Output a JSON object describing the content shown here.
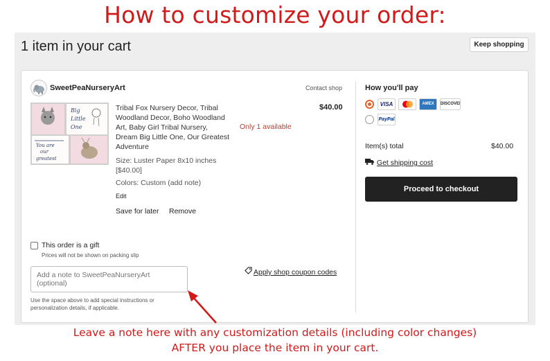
{
  "headline": "How to customize your order:",
  "cart": {
    "title": "1 item in your cart",
    "keep_shopping": "Keep shopping"
  },
  "shop": {
    "name": "SweetPeaNurseryArt",
    "logo_icon": "elephant-icon",
    "contact": "Contact shop"
  },
  "item": {
    "image_texts": [
      "Big",
      "Little",
      "One",
      "You are",
      "our",
      "greatest"
    ],
    "title": "Tribal Fox Nursery Decor, Tribal Woodland Decor, Boho Woodland Art, Baby Girl Tribal Nursery, Dream Big Little One, Our Greatest Adventure",
    "availability": "Only 1 available",
    "price": "$40.00",
    "size": "Size: Luster Paper 8x10 inches [$40.00]",
    "colors": "Colors: Custom (add note)",
    "edit": "Edit",
    "save_for_later": "Save for later",
    "remove": "Remove"
  },
  "gift": {
    "label": "This order is a gift",
    "subtext": "Prices will not be shown on packing slip"
  },
  "note": {
    "placeholder": "Add a note to SweetPeaNurseryArt (optional)",
    "help": "Use the space above to add special instructions or personalization details, if applicable."
  },
  "coupon": {
    "icon": "tag-icon",
    "label": "Apply shop coupon codes"
  },
  "payment": {
    "title": "How you'll pay",
    "methods": [
      {
        "name": "card",
        "selected": true,
        "logos": [
          "VISA",
          "mastercard",
          "AMEX",
          "DISCOVER"
        ]
      },
      {
        "name": "paypal",
        "selected": false,
        "logos": [
          "PayPal"
        ]
      }
    ],
    "items_label": "Item(s) total",
    "items_total": "$40.00",
    "shipping_label": "Get shipping cost",
    "shipping_icon": "truck-icon",
    "checkout": "Proceed to checkout"
  },
  "colors": {
    "headline_red": "#d11a1a",
    "accent_orange": "#e2622a",
    "checkout_bg": "#222222",
    "availability_red": "#c0392b"
  },
  "caption": {
    "line1": "Leave a note here with any customization details (including color changes)",
    "line2": "AFTER you place the item in your cart."
  }
}
